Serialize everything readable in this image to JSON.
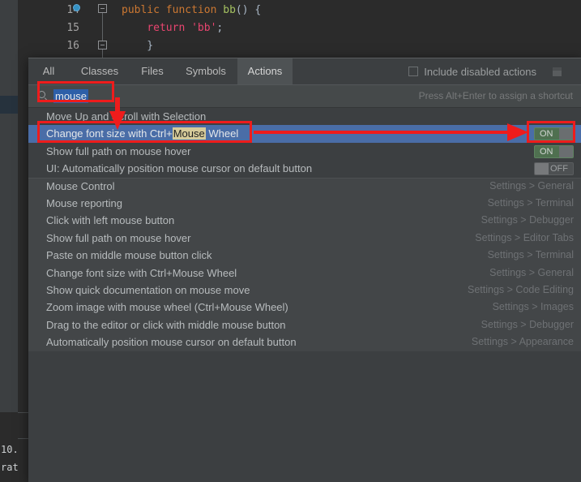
{
  "editor": {
    "lines": [
      {
        "num": "14",
        "tokens": [
          {
            "t": "public",
            "c": "kw"
          },
          {
            "t": " ",
            "c": "punct"
          },
          {
            "t": "function",
            "c": "kw"
          },
          {
            "t": " ",
            "c": "punct"
          },
          {
            "t": "bb",
            "c": "fn"
          },
          {
            "t": "() {",
            "c": "punct"
          }
        ]
      },
      {
        "num": "15",
        "tokens": [
          {
            "t": "    return ",
            "c": "kw"
          },
          {
            "t": "'bb'",
            "c": "str"
          },
          {
            "t": ";",
            "c": "punct"
          }
        ]
      },
      {
        "num": "16",
        "tokens": [
          {
            "t": "}",
            "c": "punct"
          }
        ]
      }
    ],
    "line14": "public function bb() {",
    "line15": "    return 'bb';",
    "line16": "}",
    "terminal_line1": "10.",
    "terminal_line2": "rat"
  },
  "popup": {
    "tabs": [
      {
        "label": "All",
        "active": false
      },
      {
        "label": "Classes",
        "active": false
      },
      {
        "label": "Files",
        "active": false
      },
      {
        "label": "Symbols",
        "active": false
      },
      {
        "label": "Actions",
        "active": true
      }
    ],
    "include_disabled_label": "Include disabled actions",
    "include_disabled_checked": false,
    "search_value": "mouse",
    "shortcut_hint": "Press Alt+Enter to assign a shortcut",
    "results": [
      {
        "label": "Move Up and Scroll with Selection",
        "right": "",
        "toggle": null,
        "selected": false,
        "group": "a",
        "match": null
      },
      {
        "label": "Change font size with Ctrl+Mouse Wheel",
        "right": "",
        "toggle": "ON",
        "selected": true,
        "group": "a",
        "match": "Mouse",
        "pre": "Change font size with Ctrl+",
        "post": " Wheel"
      },
      {
        "label": "Show full path on mouse hover",
        "right": "",
        "toggle": "ON",
        "selected": false,
        "group": "a",
        "match": null
      },
      {
        "label": "UI: Automatically position mouse cursor on default button",
        "right": "",
        "toggle": "OFF",
        "selected": false,
        "group": "a",
        "match": null
      },
      {
        "label": "Mouse Control",
        "right": "Settings > General",
        "toggle": null,
        "selected": false,
        "group": "b",
        "match": null
      },
      {
        "label": "Mouse reporting",
        "right": "Settings > Terminal",
        "toggle": null,
        "selected": false,
        "group": "b",
        "match": null
      },
      {
        "label": "Click with left mouse button",
        "right": "Settings > Debugger",
        "toggle": null,
        "selected": false,
        "group": "b",
        "match": null
      },
      {
        "label": "Show full path on mouse hover",
        "right": "Settings > Editor Tabs",
        "toggle": null,
        "selected": false,
        "group": "b",
        "match": null
      },
      {
        "label": "Paste on middle mouse button click",
        "right": "Settings > Terminal",
        "toggle": null,
        "selected": false,
        "group": "b",
        "match": null
      },
      {
        "label": "Change font size with Ctrl+Mouse Wheel",
        "right": "Settings > General",
        "toggle": null,
        "selected": false,
        "group": "b",
        "match": null
      },
      {
        "label": "Show quick documentation on mouse move",
        "right": "Settings > Code Editing",
        "toggle": null,
        "selected": false,
        "group": "b",
        "match": null
      },
      {
        "label": "Zoom image with mouse wheel (Ctrl+Mouse Wheel)",
        "right": "Settings > Images",
        "toggle": null,
        "selected": false,
        "group": "b",
        "match": null
      },
      {
        "label": "Drag to the editor or click with middle mouse button",
        "right": "Settings > Debugger",
        "toggle": null,
        "selected": false,
        "group": "b",
        "match": null
      },
      {
        "label": "Automatically position mouse cursor on default button",
        "right": "Settings > Appearance",
        "toggle": null,
        "selected": false,
        "group": "b",
        "match": null
      }
    ]
  },
  "annotations": {
    "color": "#ee1c1c",
    "search_box_highlight": true,
    "selected_row_highlight": true,
    "toggle_highlight": true,
    "arrow_down": true,
    "arrow_right": true
  }
}
